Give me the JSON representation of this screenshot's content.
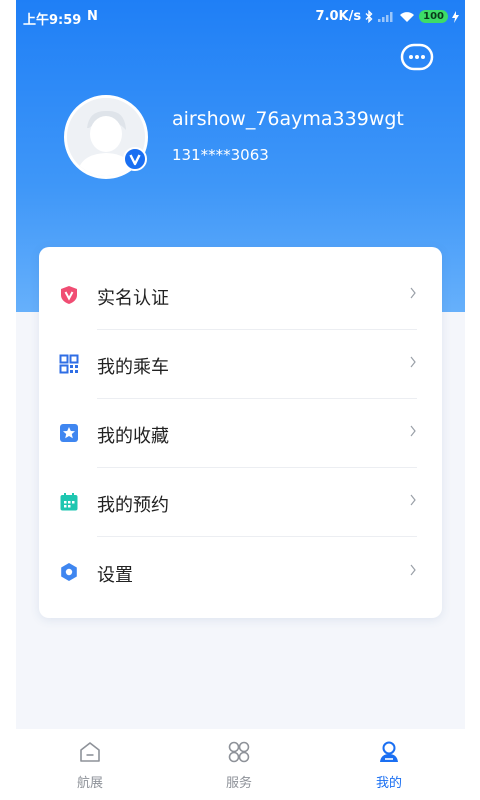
{
  "status_bar": {
    "time": "上午9:59",
    "notification_glyph": "N",
    "net_speed": "7.0K/s",
    "battery": "100",
    "icons": [
      "bluetooth-icon",
      "signal-icon",
      "wifi-icon",
      "battery-icon",
      "charging-icon"
    ]
  },
  "header": {
    "message_button_icon": "chat-bubble-icon"
  },
  "profile": {
    "username": "airshow_76ayma339wgt",
    "phone": "131****3063",
    "badge_icon": "verified-v-icon"
  },
  "menu": {
    "items": [
      {
        "label": "实名认证",
        "icon": "shield-v-icon",
        "color": "#f04d73"
      },
      {
        "label": "我的乘车",
        "icon": "qr-code-icon",
        "color": "#2f6ee5"
      },
      {
        "label": "我的收藏",
        "icon": "star-icon",
        "color": "#3f86f0"
      },
      {
        "label": "我的预约",
        "icon": "calendar-icon",
        "color": "#1ec6b0"
      },
      {
        "label": "设置",
        "icon": "gear-icon",
        "color": "#3f86f0"
      }
    ]
  },
  "tab_bar": {
    "tabs": [
      {
        "label": "航展",
        "icon": "home-icon",
        "active": false
      },
      {
        "label": "服务",
        "icon": "grid-circles-icon",
        "active": false
      },
      {
        "label": "我的",
        "icon": "person-icon",
        "active": true
      }
    ]
  },
  "colors": {
    "header_gradient_top": "#1f7ff6",
    "accent": "#1a6ff2",
    "background": "#f4f6fb",
    "battery": "#3ddc67"
  }
}
